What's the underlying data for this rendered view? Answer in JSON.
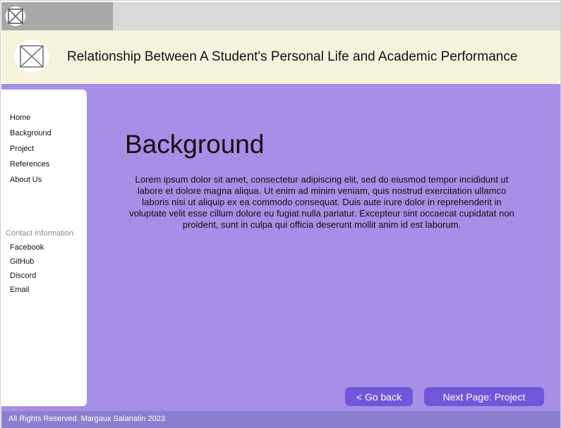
{
  "header": {
    "title": "Relationship Between A Student's Personal Life and Academic Performance",
    "logo_icon": "image-placeholder-icon"
  },
  "top_bar": {
    "logo_icon": "image-placeholder-icon"
  },
  "sidebar": {
    "nav_items": [
      "Home",
      "Background",
      "Project",
      "References",
      "About Us"
    ],
    "contact_heading": "Contact Information",
    "contact_items": [
      "Facebook",
      "GitHub",
      "Discord",
      "Email"
    ]
  },
  "content": {
    "title": "Background",
    "body": "Lorem ipsum dolor sit amet, consectetur adipiscing elit, sed do eiusmod tempor incididunt ut labore et dolore magna aliqua. Ut enim ad minim veniam, quis nostrud exercitation ullamco laboris nisi ut aliquip ex ea commodo consequat. Duis aute irure dolor in reprehenderit in voluptate velit esse cillum dolore eu fugiat nulla pariatur. Excepteur sint occaecat cupidatat non proident, sunt in culpa qui officia deserunt mollit anim id est laborum."
  },
  "buttons": {
    "back_label": "< Go back",
    "next_label": "Next Page: Project"
  },
  "footer": {
    "text": "All Rights Reserved. Margaux Salanatin 2023"
  },
  "colors": {
    "main_bg": "#a78ee6",
    "header_bg": "#f5f3dc",
    "button_bg": "#6f57d8",
    "footer_bg": "#8d7fd0"
  }
}
